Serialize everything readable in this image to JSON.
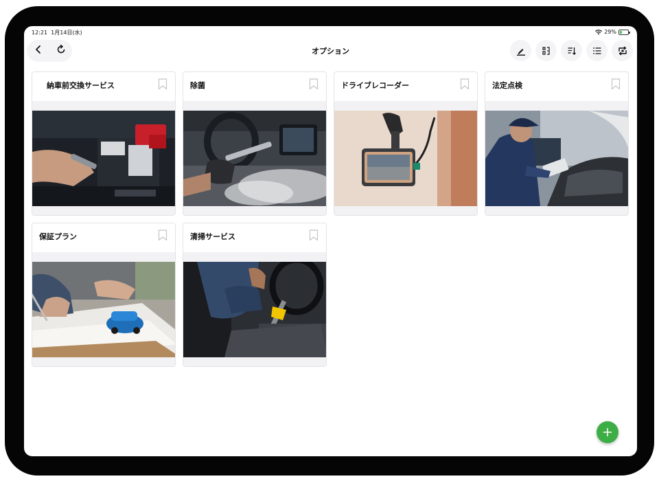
{
  "status": {
    "time": "12:21",
    "date": "1月14日(水)",
    "battery": "29%",
    "battery_level": 0.29
  },
  "header": {
    "title": "オプション"
  },
  "nav": {
    "back_icon": "chevron-left-icon",
    "refresh_icon": "refresh-icon"
  },
  "toolbar": {
    "icons": [
      "edit-icon",
      "columns-icon",
      "sort-icon",
      "list-icon",
      "swap-icon"
    ]
  },
  "cards": [
    {
      "title": "納車前交換サービス",
      "image": "car-battery-photo"
    },
    {
      "title": "除菌",
      "image": "steam-cleaning-photo"
    },
    {
      "title": "ドライブレコーダー",
      "image": "dashcam-photo"
    },
    {
      "title": "法定点検",
      "image": "mechanic-inspection-photo"
    },
    {
      "title": "保証プラン",
      "image": "warranty-contract-photo"
    },
    {
      "title": "清掃サービス",
      "image": "vacuum-cleaning-photo"
    }
  ],
  "fab": {
    "icon": "plus-icon"
  },
  "colors": {
    "accent": "#3dae45",
    "battery": "#34c759"
  }
}
